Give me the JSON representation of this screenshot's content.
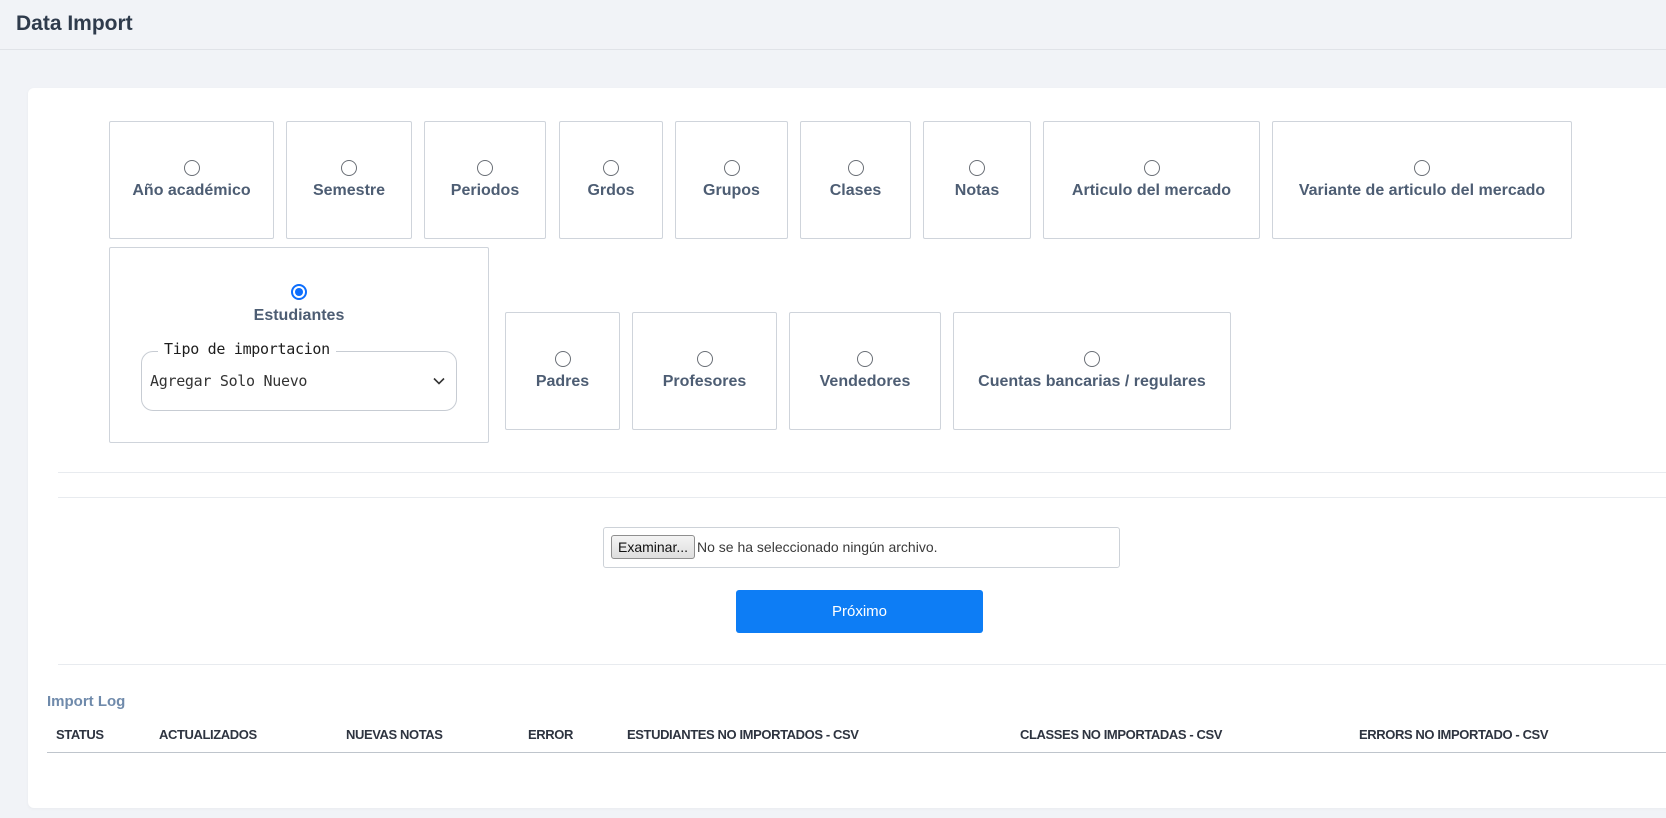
{
  "header": {
    "title": "Data Import"
  },
  "import_types": {
    "row1": [
      {
        "label": "Año académico",
        "selected": false
      },
      {
        "label": "Semestre",
        "selected": false
      },
      {
        "label": "Periodos",
        "selected": false
      },
      {
        "label": "Grdos",
        "selected": false
      },
      {
        "label": "Grupos",
        "selected": false
      },
      {
        "label": "Clases",
        "selected": false
      },
      {
        "label": "Notas",
        "selected": false
      },
      {
        "label": "Articulo del mercado",
        "selected": false
      },
      {
        "label": "Variante de articulo del mercado",
        "selected": false
      }
    ],
    "students": {
      "label": "Estudiantes",
      "selected": true,
      "import_mode_label": "Tipo de importacion",
      "import_mode_value": "Agregar Solo Nuevo"
    },
    "row2": [
      {
        "label": "Padres",
        "selected": false
      },
      {
        "label": "Profesores",
        "selected": false
      },
      {
        "label": "Vendedores",
        "selected": false
      },
      {
        "label": "Cuentas bancarias / regulares",
        "selected": false
      }
    ]
  },
  "file_input": {
    "button_label": "Examinar...",
    "status": "No se ha seleccionado ningún archivo."
  },
  "next_button": "Próximo",
  "import_log": {
    "title": "Import Log",
    "columns": [
      "STATUS",
      "ACTUALIZADOS",
      "NUEVAS NOTAS",
      "ERROR",
      "ESTUDIANTES NO IMPORTADOS - CSV",
      "CLASSES NO IMPORTADAS - CSV",
      "ERRORS NO IMPORTADO - CSV"
    ]
  },
  "colors": {
    "accent": "#0d7df5",
    "radio_checked": "#0d6efd",
    "label_text": "#4d5d73",
    "page_bg": "#f1f3f7"
  }
}
